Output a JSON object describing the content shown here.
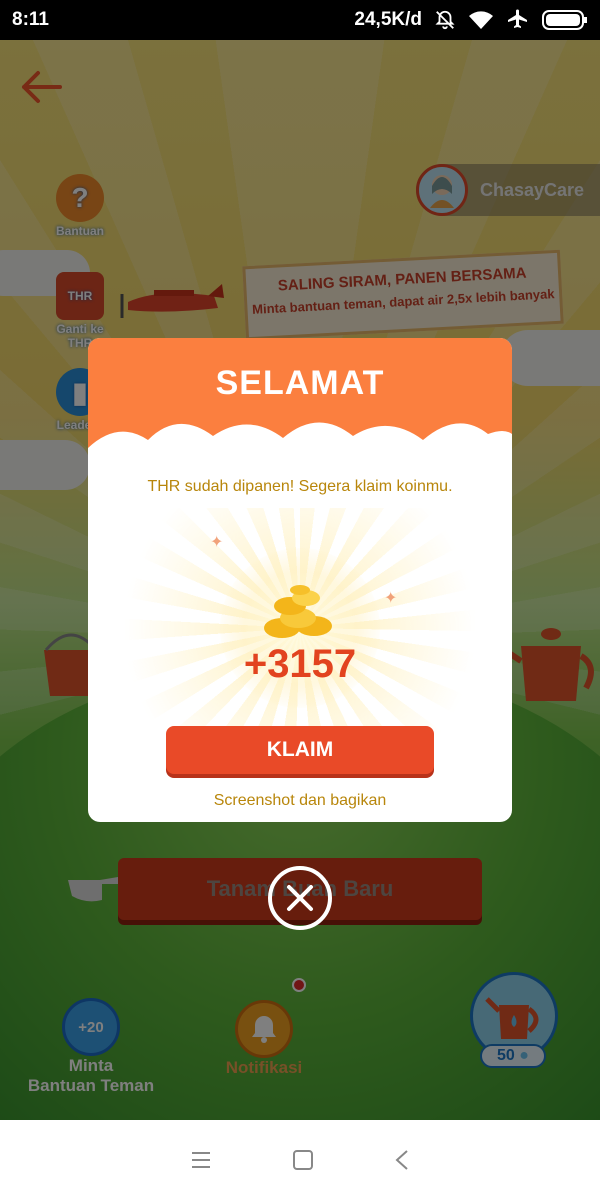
{
  "status_bar": {
    "time": "8:11",
    "speed": "24,5K/d",
    "icons": [
      "bell-off-icon",
      "wifi-icon",
      "airplane-icon",
      "battery-icon"
    ]
  },
  "game": {
    "back_icon": "back-arrow-icon",
    "side_menu": [
      {
        "label": "Bantuan",
        "icon": "help-icon"
      },
      {
        "label": "Ganti ke THR",
        "icon": "thr-icon"
      },
      {
        "label": "Leaderb",
        "icon": "leaderboard-icon"
      }
    ],
    "profile": {
      "name": "ChasayCare"
    },
    "banner": {
      "line1": "SALING SIRAM, PANEN BERSAMA",
      "line2": "Minta bantuan teman, dapat air 2,5x lebih banyak"
    },
    "plant_button": "Tanam Buah Baru",
    "bottom": {
      "help_badge": "+20",
      "help_label_1": "Minta",
      "help_label_2": "Bantuan Teman",
      "notif_label": "Notifikasi",
      "water_count": "50"
    }
  },
  "modal": {
    "title": "SELAMAT",
    "message": "THR sudah dipanen! Segera klaim koinmu.",
    "reward": "+3157",
    "claim_label": "KLAIM",
    "share_label": "Screenshot dan bagikan"
  },
  "colors": {
    "modal_header": "#fb7f3f",
    "claim_button": "#e94a28",
    "reward_text": "#e2431f",
    "message_text": "#b8860b"
  }
}
